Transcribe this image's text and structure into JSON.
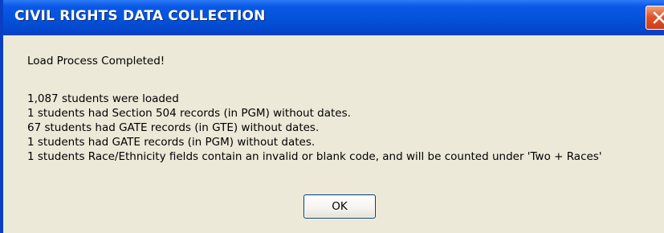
{
  "window": {
    "title": "CIVIL RIGHTS DATA COLLECTION",
    "close_icon": "close-icon"
  },
  "message": {
    "heading": "Load Process Completed!",
    "lines": [
      "1,087 students were loaded",
      "1 students had Section 504 records (in PGM) without dates.",
      "67 students had GATE records (in GTE) without dates.",
      "1 students had GATE records (in PGM) without dates.",
      "1 students Race/Ethnicity fields contain an invalid or blank code, and will be counted under 'Two + Races'"
    ]
  },
  "buttons": {
    "ok_label": "OK"
  },
  "colors": {
    "titlebar": "#0453da",
    "dialog_background": "#ece9d8",
    "close_button": "#e0542c"
  }
}
